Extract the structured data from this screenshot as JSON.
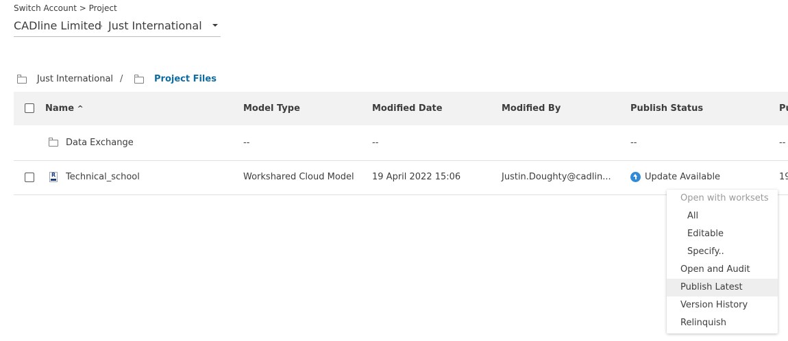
{
  "top_breadcrumb": "Switch Account > Project",
  "account": {
    "name": "CADline Limited",
    "separator": "›",
    "project": "Just International"
  },
  "path": {
    "root": "Just International",
    "separator": "/",
    "current": "Project Files"
  },
  "table": {
    "columns": [
      "Name",
      "Model Type",
      "Modified Date",
      "Modified By",
      "Publish Status",
      "Pu"
    ],
    "sort_indicator": "^",
    "rows": [
      {
        "name": "Data Exchange",
        "model_type": "--",
        "modified_date": "--",
        "modified_by": "",
        "publish_status": "--",
        "extra": "--"
      },
      {
        "name": "Technical_school",
        "model_type": "Workshared Cloud Model",
        "modified_date": "19 April 2022 15:06",
        "modified_by": "Justin.Doughty@cadlin...",
        "publish_status": "Update Available",
        "extra": "19"
      }
    ]
  },
  "context_menu": {
    "header": "Open with worksets",
    "items": [
      "All",
      "Editable",
      "Specify..",
      "Open and Audit",
      "Publish Latest",
      "Version History",
      "Relinquish"
    ],
    "highlighted": "Publish Latest"
  },
  "colors": {
    "link": "#0e6ca3",
    "status_icon": "#2f8ad8",
    "header_bg": "#f2f2f2"
  },
  "icons": {
    "folder": "folder-icon",
    "revit_file": "revit-file-icon",
    "update": "update-available-icon"
  }
}
